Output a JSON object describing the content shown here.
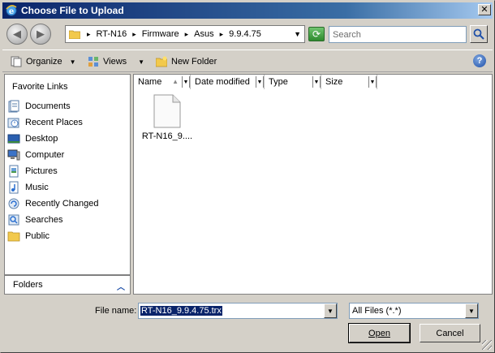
{
  "window": {
    "title": "Choose File to Upload",
    "close_glyph": "✕"
  },
  "address": {
    "breadcrumbs": [
      "RT-N16",
      "Firmware",
      "Asus",
      "9.9.4.75"
    ],
    "separator": "▸",
    "search_placeholder": "Search"
  },
  "toolbar": {
    "organize_label": "Organize",
    "views_label": "Views",
    "new_folder_label": "New Folder",
    "help_glyph": "?"
  },
  "nav": {
    "header": "Favorite Links",
    "items": [
      {
        "label": "Documents",
        "icon": "documents-icon"
      },
      {
        "label": "Recent Places",
        "icon": "recent-places-icon"
      },
      {
        "label": "Desktop",
        "icon": "desktop-icon"
      },
      {
        "label": "Computer",
        "icon": "computer-icon"
      },
      {
        "label": "Pictures",
        "icon": "pictures-icon"
      },
      {
        "label": "Music",
        "icon": "music-icon"
      },
      {
        "label": "Recently Changed",
        "icon": "recently-changed-icon"
      },
      {
        "label": "Searches",
        "icon": "searches-icon"
      },
      {
        "label": "Public",
        "icon": "public-folder-icon"
      }
    ],
    "folders_label": "Folders"
  },
  "files": {
    "columns": [
      "Name",
      "Date modified",
      "Type",
      "Size"
    ],
    "items": [
      {
        "name": "RT-N16_9...."
      }
    ]
  },
  "bottom": {
    "file_name_label": "File name:",
    "file_name_value": "RT-N16_9.9.4.75.trx",
    "file_type_value": "All Files (*.*)",
    "open_label": "Open",
    "cancel_label": "Cancel"
  },
  "colors": {
    "accent": "#0a246a",
    "chrome": "#d4d0c8"
  }
}
